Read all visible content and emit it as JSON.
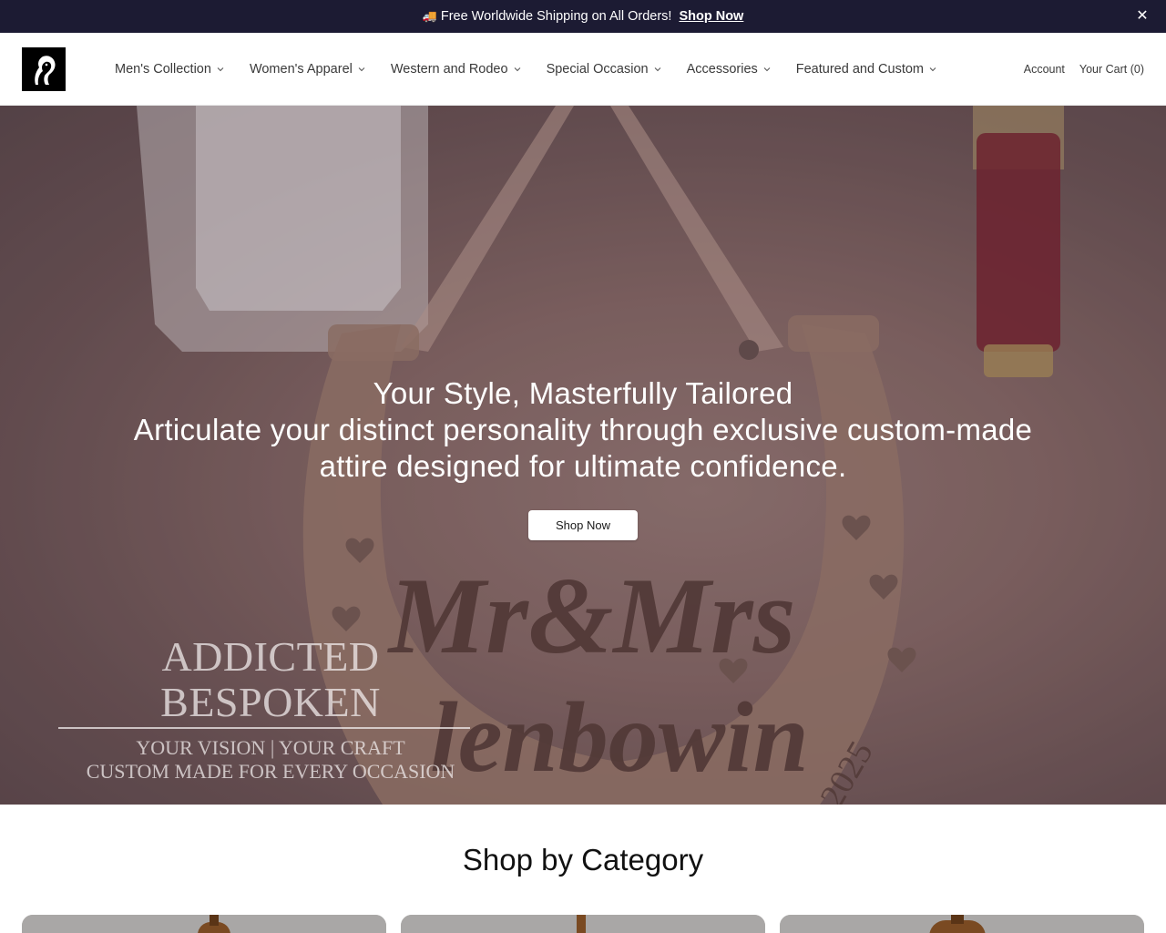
{
  "announcement": {
    "truck_icon": "🚚",
    "text": "Free Worldwide Shipping on All Orders!",
    "link": "Shop Now",
    "close": "✕"
  },
  "header": {
    "nav": [
      {
        "label": "Men's Collection"
      },
      {
        "label": "Women's Apparel"
      },
      {
        "label": "Western and Rodeo"
      },
      {
        "label": "Special Occasion"
      },
      {
        "label": "Accessories"
      },
      {
        "label": "Featured and Custom"
      }
    ],
    "account": "Account",
    "cart": "Your Cart (0)"
  },
  "hero": {
    "title": "Your Style, Masterfully Tailored",
    "subtitle": "Articulate your distinct personality through exclusive custom-made attire designed for ultimate confidence.",
    "button": "Shop Now",
    "image_text": {
      "brand": "ADDICTED BESPOKEN",
      "line1": "YOUR VISION | YOUR CRAFT",
      "line2": "CUSTOM MADE FOR EVERY OCCASION",
      "sign_script": "Mr&Mrs",
      "sign_name": "lenbowin",
      "sign_year": "2025"
    }
  },
  "categories": {
    "heading": "Shop by Category"
  },
  "colors": {
    "announcement_bg": "#1c1b33",
    "hero_tone": "#8b6c68",
    "card_bg": "#a9a7a6"
  }
}
